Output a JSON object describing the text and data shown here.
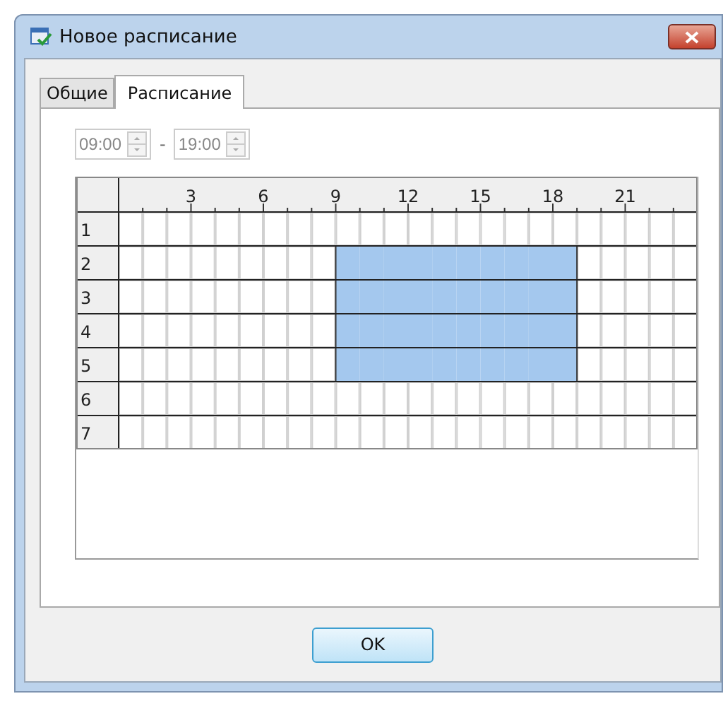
{
  "window": {
    "title": "Новое расписание"
  },
  "tabs": [
    {
      "label": "Общие",
      "selected": false
    },
    {
      "label": "Расписание",
      "selected": true
    }
  ],
  "time_range": {
    "from": {
      "value": "09:00",
      "disabled": true
    },
    "separator": "-",
    "to": {
      "value": "19:00",
      "disabled": true
    }
  },
  "grid": {
    "hour_labels": [
      "3",
      "6",
      "9",
      "12",
      "15",
      "18",
      "21"
    ],
    "rows": [
      {
        "label": "1",
        "cells": [
          {
            "selected": false
          },
          {
            "selected": false
          },
          {
            "selected": false
          },
          {
            "selected": false
          },
          {
            "selected": false
          },
          {
            "selected": false
          },
          {
            "selected": false
          },
          {
            "selected": false
          },
          {
            "selected": false
          },
          {
            "selected": false
          },
          {
            "selected": false
          },
          {
            "selected": false
          },
          {
            "selected": false
          },
          {
            "selected": false
          },
          {
            "selected": false
          },
          {
            "selected": false
          },
          {
            "selected": false
          },
          {
            "selected": false
          },
          {
            "selected": false
          },
          {
            "selected": false
          },
          {
            "selected": false
          },
          {
            "selected": false
          },
          {
            "selected": false
          },
          {
            "selected": false
          }
        ]
      },
      {
        "label": "2",
        "cells": [
          {
            "selected": false
          },
          {
            "selected": false
          },
          {
            "selected": false
          },
          {
            "selected": false
          },
          {
            "selected": false
          },
          {
            "selected": false
          },
          {
            "selected": false
          },
          {
            "selected": false
          },
          {
            "selected": false
          },
          {
            "selected": true
          },
          {
            "selected": true
          },
          {
            "selected": true
          },
          {
            "selected": true
          },
          {
            "selected": true
          },
          {
            "selected": true
          },
          {
            "selected": true
          },
          {
            "selected": true
          },
          {
            "selected": true
          },
          {
            "selected": true
          },
          {
            "selected": false
          },
          {
            "selected": false
          },
          {
            "selected": false
          },
          {
            "selected": false
          },
          {
            "selected": false
          }
        ]
      },
      {
        "label": "3",
        "cells": [
          {
            "selected": false
          },
          {
            "selected": false
          },
          {
            "selected": false
          },
          {
            "selected": false
          },
          {
            "selected": false
          },
          {
            "selected": false
          },
          {
            "selected": false
          },
          {
            "selected": false
          },
          {
            "selected": false
          },
          {
            "selected": true
          },
          {
            "selected": true
          },
          {
            "selected": true
          },
          {
            "selected": true
          },
          {
            "selected": true
          },
          {
            "selected": true
          },
          {
            "selected": true
          },
          {
            "selected": true
          },
          {
            "selected": true
          },
          {
            "selected": true
          },
          {
            "selected": false
          },
          {
            "selected": false
          },
          {
            "selected": false
          },
          {
            "selected": false
          },
          {
            "selected": false
          }
        ]
      },
      {
        "label": "4",
        "cells": [
          {
            "selected": false
          },
          {
            "selected": false
          },
          {
            "selected": false
          },
          {
            "selected": false
          },
          {
            "selected": false
          },
          {
            "selected": false
          },
          {
            "selected": false
          },
          {
            "selected": false
          },
          {
            "selected": false
          },
          {
            "selected": true
          },
          {
            "selected": true
          },
          {
            "selected": true
          },
          {
            "selected": true
          },
          {
            "selected": true
          },
          {
            "selected": true
          },
          {
            "selected": true
          },
          {
            "selected": true
          },
          {
            "selected": true
          },
          {
            "selected": true
          },
          {
            "selected": false
          },
          {
            "selected": false
          },
          {
            "selected": false
          },
          {
            "selected": false
          },
          {
            "selected": false
          }
        ]
      },
      {
        "label": "5",
        "cells": [
          {
            "selected": false
          },
          {
            "selected": false
          },
          {
            "selected": false
          },
          {
            "selected": false
          },
          {
            "selected": false
          },
          {
            "selected": false
          },
          {
            "selected": false
          },
          {
            "selected": false
          },
          {
            "selected": false
          },
          {
            "selected": true
          },
          {
            "selected": true
          },
          {
            "selected": true
          },
          {
            "selected": true
          },
          {
            "selected": true
          },
          {
            "selected": true
          },
          {
            "selected": true
          },
          {
            "selected": true
          },
          {
            "selected": true
          },
          {
            "selected": true
          },
          {
            "selected": false
          },
          {
            "selected": false
          },
          {
            "selected": false
          },
          {
            "selected": false
          },
          {
            "selected": false
          }
        ]
      },
      {
        "label": "6",
        "cells": [
          {
            "selected": false
          },
          {
            "selected": false
          },
          {
            "selected": false
          },
          {
            "selected": false
          },
          {
            "selected": false
          },
          {
            "selected": false
          },
          {
            "selected": false
          },
          {
            "selected": false
          },
          {
            "selected": false
          },
          {
            "selected": false
          },
          {
            "selected": false
          },
          {
            "selected": false
          },
          {
            "selected": false
          },
          {
            "selected": false
          },
          {
            "selected": false
          },
          {
            "selected": false
          },
          {
            "selected": false
          },
          {
            "selected": false
          },
          {
            "selected": false
          },
          {
            "selected": false
          },
          {
            "selected": false
          },
          {
            "selected": false
          },
          {
            "selected": false
          },
          {
            "selected": false
          }
        ]
      },
      {
        "label": "7",
        "cells": [
          {
            "selected": false
          },
          {
            "selected": false
          },
          {
            "selected": false
          },
          {
            "selected": false
          },
          {
            "selected": false
          },
          {
            "selected": false
          },
          {
            "selected": false
          },
          {
            "selected": false
          },
          {
            "selected": false
          },
          {
            "selected": false
          },
          {
            "selected": false
          },
          {
            "selected": false
          },
          {
            "selected": false
          },
          {
            "selected": false
          },
          {
            "selected": false
          },
          {
            "selected": false
          },
          {
            "selected": false
          },
          {
            "selected": false
          },
          {
            "selected": false
          },
          {
            "selected": false
          },
          {
            "selected": false
          },
          {
            "selected": false
          },
          {
            "selected": false
          },
          {
            "selected": false
          }
        ]
      }
    ]
  },
  "buttons": [
    "OK"
  ]
}
